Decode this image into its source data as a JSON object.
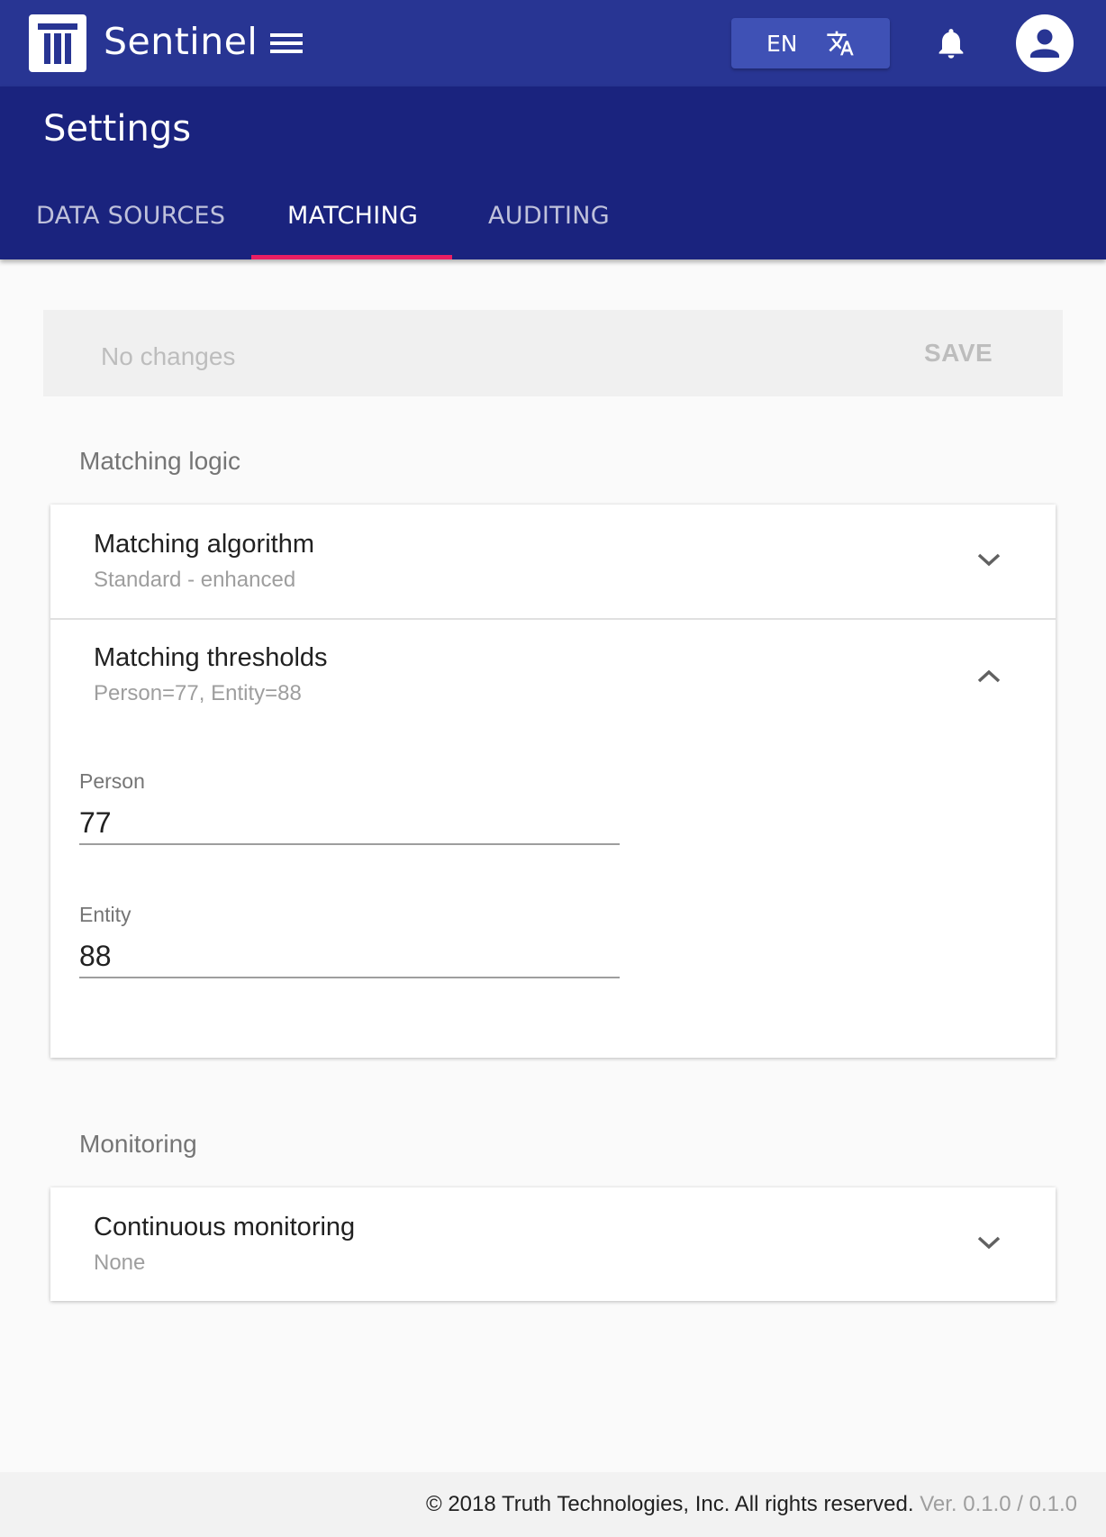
{
  "app": {
    "title": "Sentinel",
    "logo_icon": "logo-t-icon",
    "menu_icon": "hamburger-menu-icon"
  },
  "topbar": {
    "language": "EN",
    "translate_icon": "translate-icon",
    "notifications_icon": "bell-icon",
    "account_icon": "account-circle-icon"
  },
  "colors": {
    "topbar": "#283593",
    "header": "#1a237e",
    "accent": "#e91e63",
    "language_button": "#3f51b5"
  },
  "header": {
    "title": "Settings",
    "tabs": [
      {
        "label": "DATA SOURCES",
        "active": false
      },
      {
        "label": "MATCHING",
        "active": true
      },
      {
        "label": "AUDITING",
        "active": false
      }
    ]
  },
  "save_bar": {
    "status": "No changes",
    "save_label": "SAVE"
  },
  "sections": {
    "matching_logic": {
      "heading": "Matching logic",
      "panels": [
        {
          "title": "Matching algorithm",
          "summary": "Standard - enhanced",
          "expanded": false
        },
        {
          "title": "Matching thresholds",
          "summary": "Person=77, Entity=88",
          "expanded": true
        }
      ],
      "fields": [
        {
          "label": "Person",
          "value": "77"
        },
        {
          "label": "Entity",
          "value": "88"
        }
      ]
    },
    "monitoring": {
      "heading": "Monitoring",
      "panels": [
        {
          "title": "Continuous monitoring",
          "summary": "None",
          "expanded": false
        }
      ]
    }
  },
  "footer": {
    "copyright": "© 2018 Truth Technologies, Inc. All rights reserved.",
    "version": "Ver. 0.1.0 / 0.1.0"
  }
}
